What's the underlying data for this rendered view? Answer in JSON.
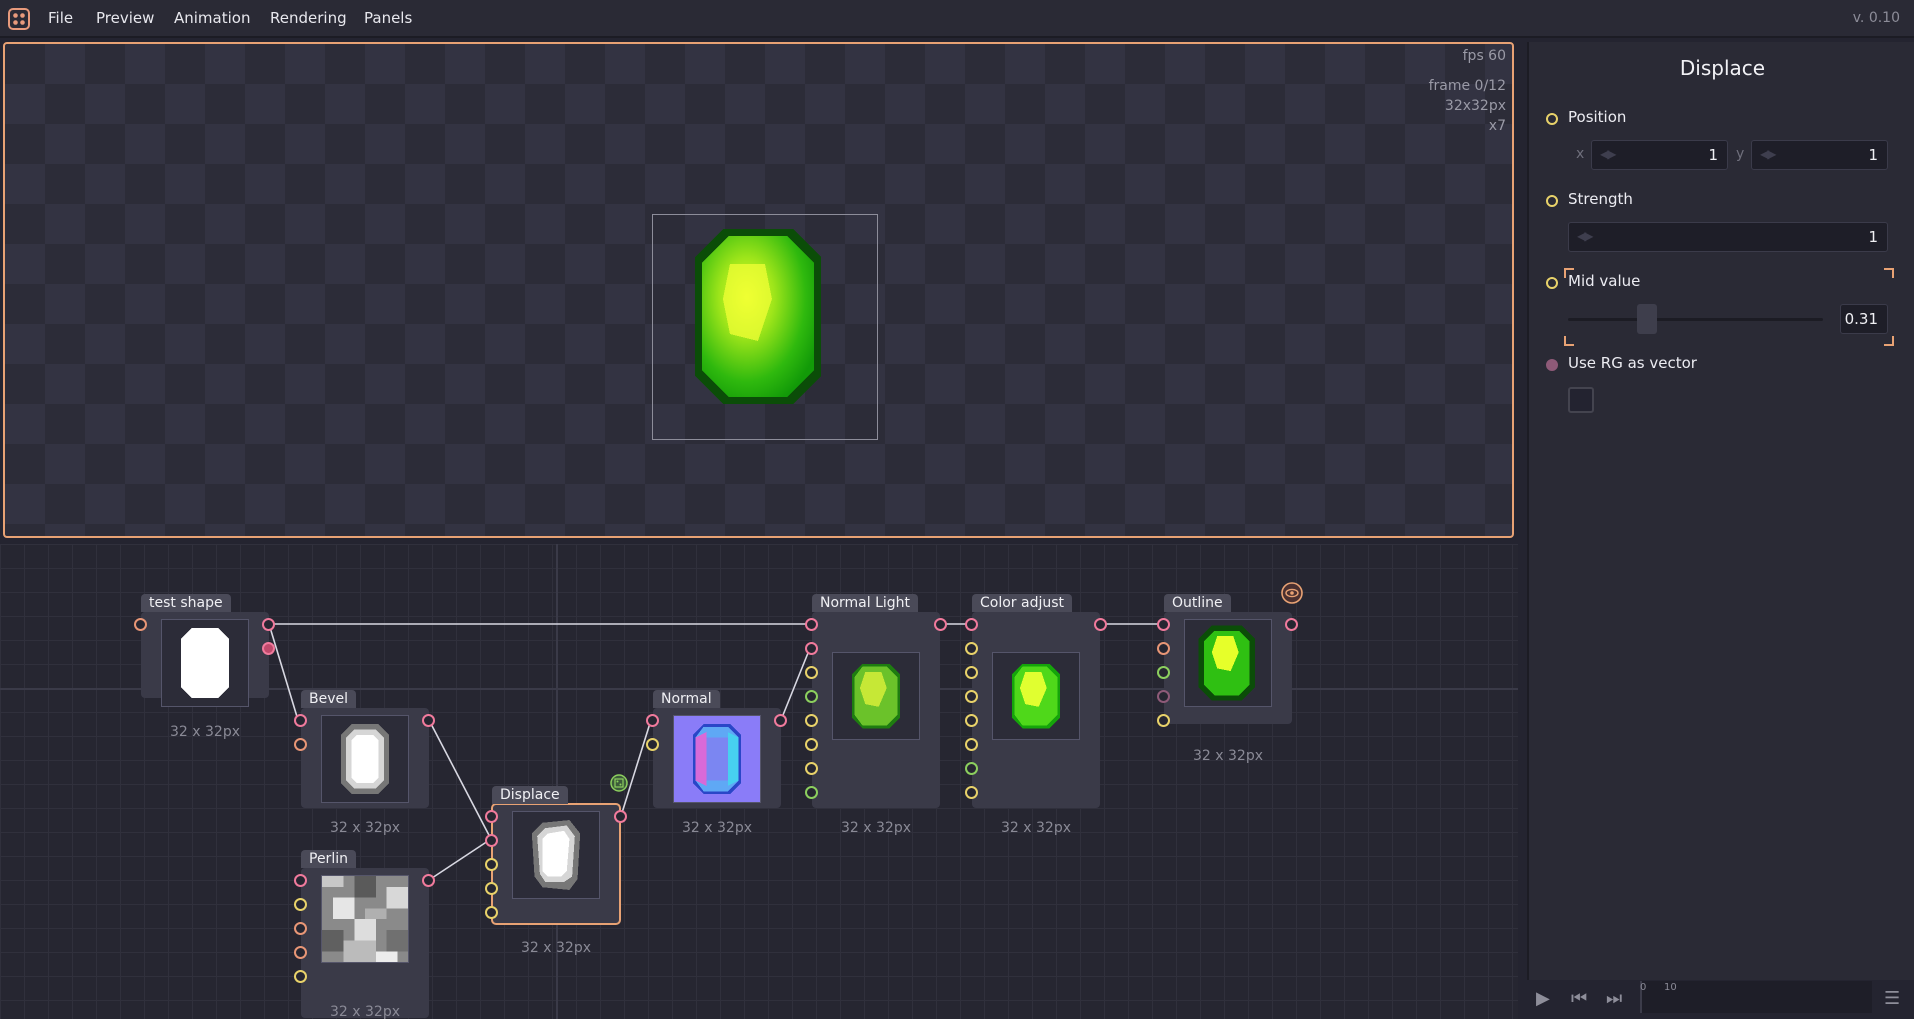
{
  "menubar": {
    "items": [
      "File",
      "Preview",
      "Animation",
      "Rendering",
      "Panels"
    ],
    "version": "v. 0.10"
  },
  "preview": {
    "fps": "fps 60",
    "frame": "frame 0/12",
    "size": "32x32px",
    "zoom": "x7"
  },
  "nodes": [
    {
      "id": "test-shape",
      "title": "test shape",
      "size": "32 x 32px"
    },
    {
      "id": "bevel",
      "title": "Bevel",
      "size": "32 x 32px"
    },
    {
      "id": "perlin",
      "title": "Perlin",
      "size": "32 x 32px"
    },
    {
      "id": "displace",
      "title": "Displace",
      "size": "32 x 32px"
    },
    {
      "id": "normal",
      "title": "Normal",
      "size": "32 x 32px"
    },
    {
      "id": "normal-light",
      "title": "Normal Light",
      "size": "32 x 32px"
    },
    {
      "id": "color-adjust",
      "title": "Color adjust",
      "size": "32 x 32px"
    },
    {
      "id": "outline",
      "title": "Outline",
      "size": "32 x 32px"
    }
  ],
  "inspector": {
    "title": "Displace",
    "position": {
      "label": "Position",
      "x_label": "x",
      "y_label": "y",
      "x_value": "1",
      "y_value": "1"
    },
    "strength": {
      "label": "Strength",
      "value": "1"
    },
    "mid_value": {
      "label": "Mid value",
      "value": "0.31",
      "slider_fraction": 0.31
    },
    "use_rg": {
      "label": "Use RG as vector",
      "checked": false
    }
  },
  "timeline": {
    "tick_start": "0",
    "tick_10": "10"
  },
  "colors": {
    "accent": "#e8a274",
    "wire": "#d8d8e2",
    "port_pink": "#f07a9c",
    "port_yellow": "#e8d26a",
    "port_green": "#8ccf5e"
  }
}
